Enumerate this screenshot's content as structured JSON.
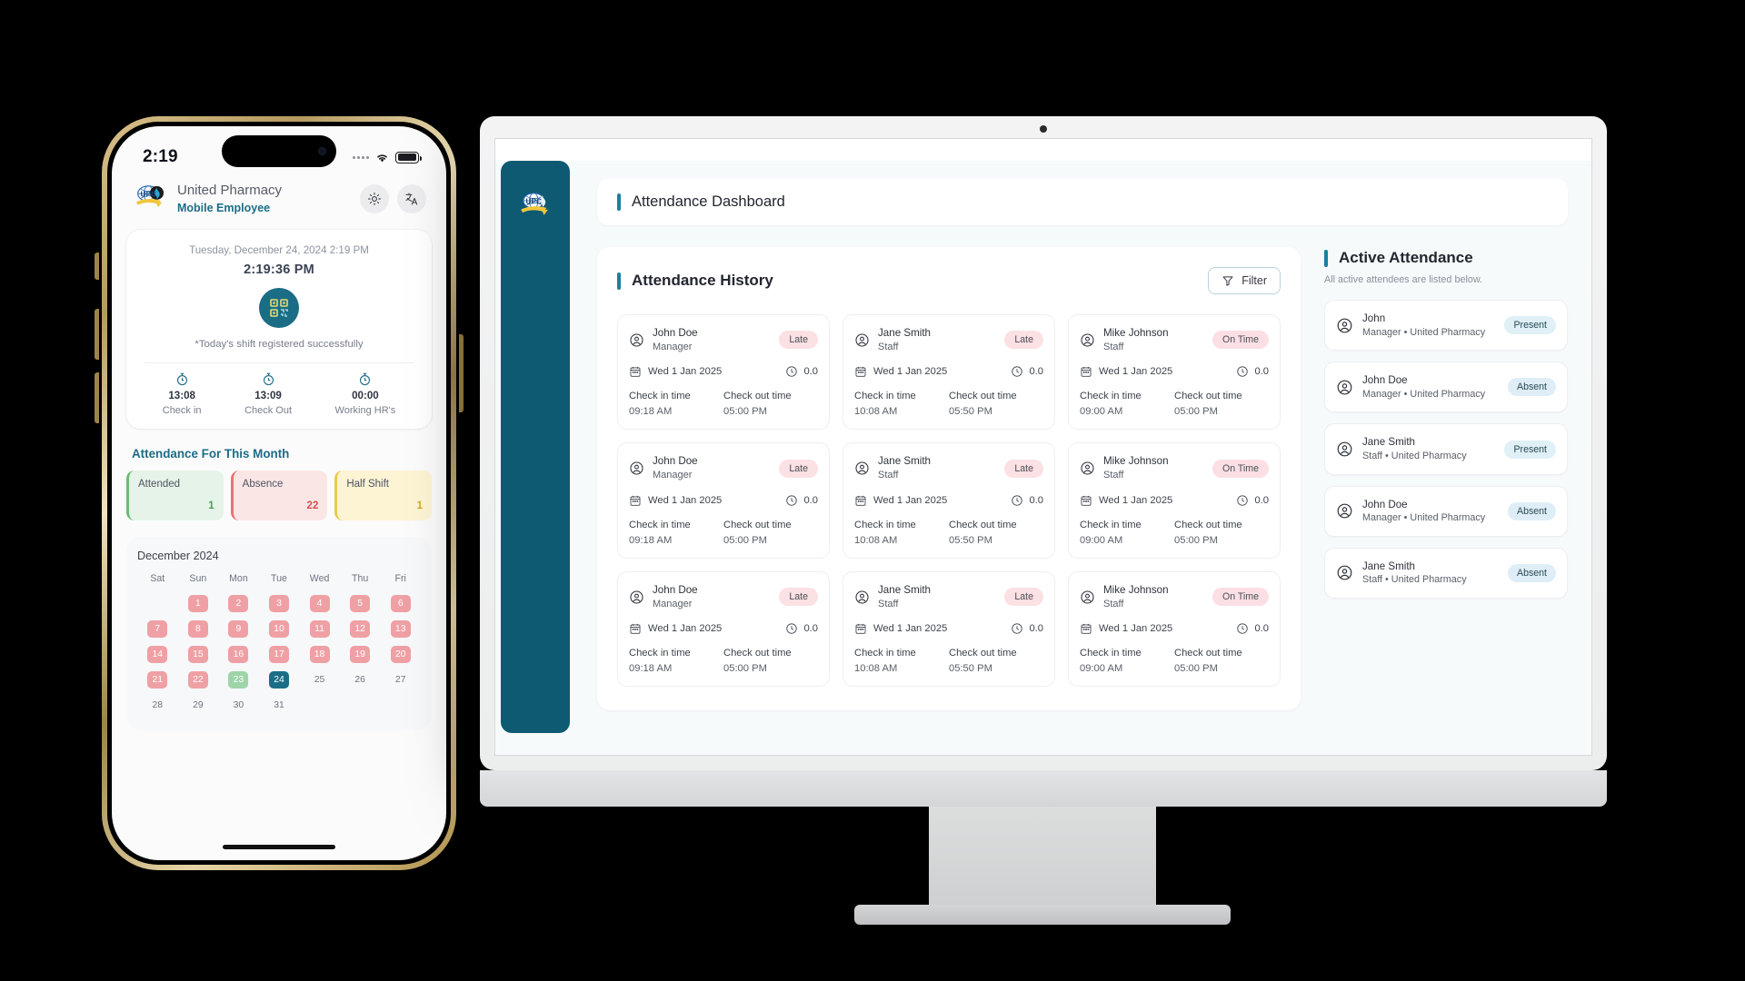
{
  "phone": {
    "status": {
      "time": "2:19",
      "battery_icon": "battery-icon",
      "wifi_icon": "wifi-icon",
      "signal_icon": "signal-dots-icon"
    },
    "header": {
      "company": "United Pharmacy",
      "role": "Mobile Employee",
      "theme_icon": "sun-icon",
      "language_icon": "translate-icon",
      "logo": "upc-logo"
    },
    "clock_card": {
      "date_line": "Tuesday, December 24, 2024 2:19 PM",
      "time_line": "2:19:36 PM",
      "qr_icon": "qr-code-icon",
      "message": "*Today's shift registered successfully",
      "times": [
        {
          "icon": "stopwatch-icon",
          "value": "13:08",
          "label": "Check in"
        },
        {
          "icon": "stopwatch-icon",
          "value": "13:09",
          "label": "Check Out"
        },
        {
          "icon": "stopwatch-icon",
          "value": "00:00",
          "label": "Working HR's"
        }
      ]
    },
    "month_section_title": "Attendance For This Month",
    "stats": [
      {
        "label": "Attended",
        "value": "1",
        "color": "#4b9f57"
      },
      {
        "label": "Absence",
        "value": "22",
        "color": "#dc4c4c"
      },
      {
        "label": "Half Shift",
        "value": "1",
        "color": "#cfa81c"
      }
    ],
    "calendar": {
      "title": "December 2024",
      "dow": [
        "Sat",
        "Sun",
        "Mon",
        "Tue",
        "Wed",
        "Thu",
        "Fri"
      ],
      "leading_blanks": 1,
      "days": [
        {
          "d": "1",
          "state": "absent"
        },
        {
          "d": "2",
          "state": "absent"
        },
        {
          "d": "3",
          "state": "absent"
        },
        {
          "d": "4",
          "state": "absent"
        },
        {
          "d": "5",
          "state": "absent"
        },
        {
          "d": "6",
          "state": "absent"
        },
        {
          "d": "7",
          "state": "absent"
        },
        {
          "d": "8",
          "state": "absent"
        },
        {
          "d": "9",
          "state": "absent"
        },
        {
          "d": "10",
          "state": "absent"
        },
        {
          "d": "11",
          "state": "absent"
        },
        {
          "d": "12",
          "state": "absent"
        },
        {
          "d": "13",
          "state": "absent"
        },
        {
          "d": "14",
          "state": "absent"
        },
        {
          "d": "15",
          "state": "absent"
        },
        {
          "d": "16",
          "state": "absent"
        },
        {
          "d": "17",
          "state": "absent"
        },
        {
          "d": "18",
          "state": "absent"
        },
        {
          "d": "19",
          "state": "absent"
        },
        {
          "d": "20",
          "state": "absent"
        },
        {
          "d": "21",
          "state": "absent"
        },
        {
          "d": "22",
          "state": "absent"
        },
        {
          "d": "23",
          "state": "present"
        },
        {
          "d": "24",
          "state": "today"
        },
        {
          "d": "25",
          "state": "none"
        },
        {
          "d": "26",
          "state": "none"
        },
        {
          "d": "27",
          "state": "none"
        },
        {
          "d": "28",
          "state": "none"
        },
        {
          "d": "29",
          "state": "none"
        },
        {
          "d": "30",
          "state": "none"
        },
        {
          "d": "31",
          "state": "none"
        }
      ]
    }
  },
  "desktop": {
    "sidebar": {
      "logo": "upc-logo"
    },
    "page_title": "Attendance Dashboard",
    "history": {
      "title": "Attendance History",
      "filter_label": "Filter",
      "filter_icon": "filter-icon",
      "check_in_label": "Check in time",
      "check_out_label": "Check out time",
      "cards": [
        {
          "name": "John Doe",
          "role": "Manager",
          "badge": "Late",
          "badge_type": "late",
          "date": "Wed 1 Jan 2025",
          "hours": "0.0",
          "check_in": "09:18 AM",
          "check_out": "05:00 PM"
        },
        {
          "name": "Jane Smith",
          "role": "Staff",
          "badge": "Late",
          "badge_type": "late",
          "date": "Wed 1 Jan 2025",
          "hours": "0.0",
          "check_in": "10:08 AM",
          "check_out": "05:50 PM"
        },
        {
          "name": "Mike Johnson",
          "role": "Staff",
          "badge": "On Time",
          "badge_type": "ontime",
          "date": "Wed 1 Jan 2025",
          "hours": "0.0",
          "check_in": "09:00 AM",
          "check_out": "05:00 PM"
        },
        {
          "name": "John Doe",
          "role": "Manager",
          "badge": "Late",
          "badge_type": "late",
          "date": "Wed 1 Jan 2025",
          "hours": "0.0",
          "check_in": "09:18 AM",
          "check_out": "05:00 PM"
        },
        {
          "name": "Jane Smith",
          "role": "Staff",
          "badge": "Late",
          "badge_type": "late",
          "date": "Wed 1 Jan 2025",
          "hours": "0.0",
          "check_in": "10:08 AM",
          "check_out": "05:50 PM"
        },
        {
          "name": "Mike Johnson",
          "role": "Staff",
          "badge": "On Time",
          "badge_type": "ontime",
          "date": "Wed 1 Jan 2025",
          "hours": "0.0",
          "check_in": "09:00 AM",
          "check_out": "05:00 PM"
        },
        {
          "name": "John Doe",
          "role": "Manager",
          "badge": "Late",
          "badge_type": "late",
          "date": "Wed 1 Jan 2025",
          "hours": "0.0",
          "check_in": "09:18 AM",
          "check_out": "05:00 PM"
        },
        {
          "name": "Jane Smith",
          "role": "Staff",
          "badge": "Late",
          "badge_type": "late",
          "date": "Wed 1 Jan 2025",
          "hours": "0.0",
          "check_in": "10:08 AM",
          "check_out": "05:50 PM"
        },
        {
          "name": "Mike Johnson",
          "role": "Staff",
          "badge": "On Time",
          "badge_type": "ontime",
          "date": "Wed 1 Jan 2025",
          "hours": "0.0",
          "check_in": "09:00 AM",
          "check_out": "05:00 PM"
        }
      ]
    },
    "active": {
      "title": "Active Attendance",
      "subtitle": "All active attendees are listed below.",
      "items": [
        {
          "name": "John",
          "meta": "Manager • United Pharmacy",
          "status": "Present",
          "status_type": "present"
        },
        {
          "name": "John Doe",
          "meta": "Manager • United Pharmacy",
          "status": "Absent",
          "status_type": "absent"
        },
        {
          "name": "Jane Smith",
          "meta": "Staff • United Pharmacy",
          "status": "Present",
          "status_type": "present"
        },
        {
          "name": "John Doe",
          "meta": "Manager • United Pharmacy",
          "status": "Absent",
          "status_type": "absent"
        },
        {
          "name": "Jane Smith",
          "meta": "Staff • United Pharmacy",
          "status": "Absent",
          "status_type": "absent"
        }
      ]
    }
  }
}
